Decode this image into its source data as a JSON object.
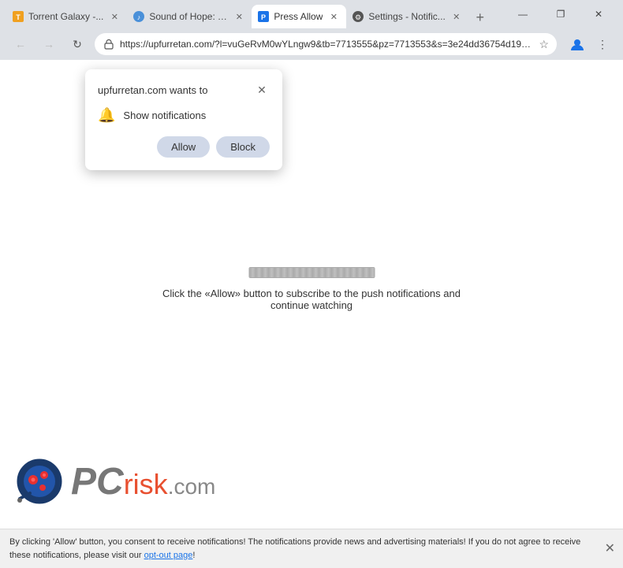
{
  "browser": {
    "tabs": [
      {
        "id": "torrent",
        "title": "Torrent Galaxy -...",
        "active": false,
        "favicon": "torrent"
      },
      {
        "id": "sound",
        "title": "Sound of Hope: T...",
        "active": false,
        "favicon": "sound"
      },
      {
        "id": "pressallow",
        "title": "Press Allow",
        "active": true,
        "favicon": "pressallow"
      },
      {
        "id": "settings",
        "title": "Settings - Notific...",
        "active": false,
        "favicon": "settings"
      }
    ],
    "url": "https://upfurretan.com/?l=vuGeRvM0wYLngw9&tb=7713555&pz=7713553&s=3e24dd36754d19b703...",
    "window_controls": {
      "minimize": "—",
      "maximize": "❐",
      "close": "✕"
    }
  },
  "notification_popup": {
    "title": "upfurretan.com wants to",
    "item": "Show notifications",
    "allow_label": "Allow",
    "block_label": "Block",
    "close_icon": "✕"
  },
  "page": {
    "loading_text": "Click the «Allow» button to subscribe to the push notifications and continue watching"
  },
  "bottom_bar": {
    "text_before_link": "By clicking 'Allow' button, you consent to receive notifications! The notifications provide news and advertising materials! If you do not agree to receive these notifications, please visit our ",
    "link_text": "opt-out page",
    "text_after_link": "!"
  },
  "pcrisk": {
    "pc_text": "PC",
    "risk_text": "risk",
    "com_text": ".com"
  }
}
